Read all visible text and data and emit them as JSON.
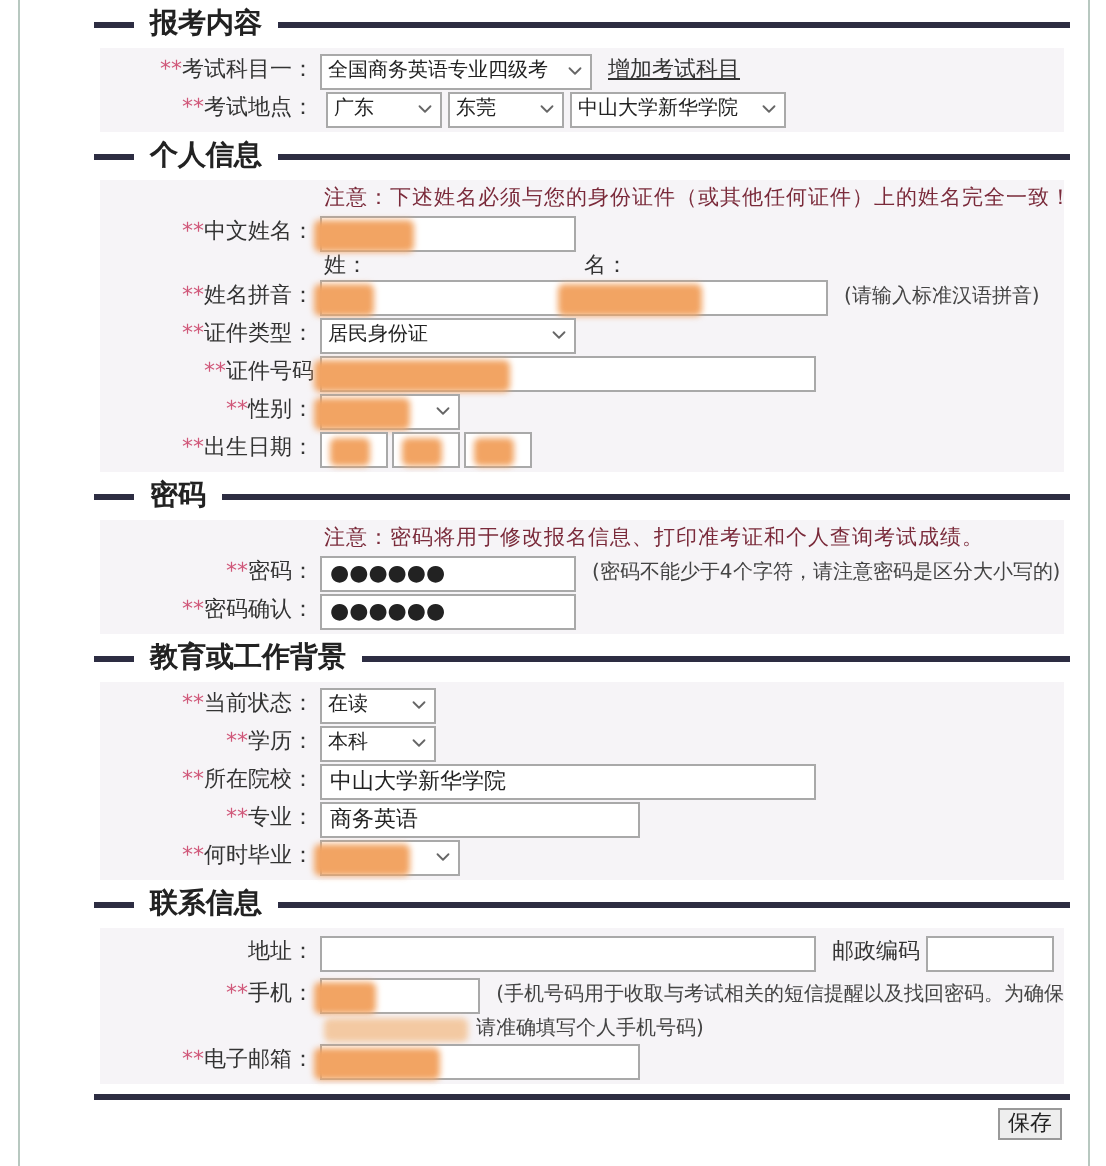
{
  "sections": [
    {
      "title": "报考内容",
      "rows": [
        {
          "kind": "select",
          "mark": "**",
          "label": "考试科目一：",
          "value": "全国商务英语专业四级考",
          "link": "增加考试科目"
        },
        {
          "kind": "selects",
          "mark": "**",
          "label": "考试地点：",
          "options": [
            "广东",
            "东莞",
            "中山大学新华学院"
          ]
        }
      ]
    },
    {
      "title": "个人信息",
      "note": "注意：下述姓名必须与您的身份证件（或其他任何证件）上的姓名完全一致！",
      "rows": [
        {
          "kind": "text",
          "mark": "**",
          "label": "中文姓名：",
          "redacted": true
        },
        {
          "kind": "name-pair",
          "mark": "**",
          "label": "姓名拼音：",
          "sublabels": [
            "姓：",
            "名："
          ],
          "redacted": true,
          "hint": "(请输入标准汉语拼音)"
        },
        {
          "kind": "select",
          "mark": "**",
          "label": "证件类型：",
          "value": "居民身份证"
        },
        {
          "kind": "text",
          "mark": "**",
          "label": "证件号码",
          "redacted": true
        },
        {
          "kind": "select",
          "mark": "**",
          "label": "性别：",
          "redacted": true
        },
        {
          "kind": "date",
          "mark": "**",
          "label": "出生日期：",
          "redacted": true
        }
      ]
    },
    {
      "title": "密码",
      "note": "注意：密码将用于修改报名信息、打印准考证和个人查询考试成绩。",
      "rows": [
        {
          "kind": "text",
          "mark": "**",
          "label": "密码：",
          "value": "●●●●●●",
          "hint": "(密码不能少于4个字符，请注意密码是区分大小写的)"
        },
        {
          "kind": "text",
          "mark": "**",
          "label": "密码确认：",
          "value": "●●●●●●"
        }
      ]
    },
    {
      "title": "教育或工作背景",
      "rows": [
        {
          "kind": "select",
          "mark": "**",
          "label": "当前状态：",
          "value": "在读"
        },
        {
          "kind": "select",
          "mark": "**",
          "label": "学历：",
          "value": "本科"
        },
        {
          "kind": "text",
          "mark": "**",
          "label": "所在院校：",
          "value": "中山大学新华学院"
        },
        {
          "kind": "text",
          "mark": "**",
          "label": "专业：",
          "value": "商务英语"
        },
        {
          "kind": "select",
          "mark": "**",
          "label": "何时毕业：",
          "redacted": true
        }
      ]
    },
    {
      "title": "联系信息",
      "rows": [
        {
          "kind": "address",
          "label": "地址：",
          "extra_label": "邮政编码"
        },
        {
          "kind": "phone",
          "mark": "**",
          "label": "手机：",
          "redacted": true,
          "hint": "(手机号码用于收取与考试相关的短信提醒以及找回密码。为确保",
          "hint_more": "请准确填写个人手机号码)"
        },
        {
          "kind": "text",
          "mark": "**",
          "label": "电子邮箱：",
          "redacted": true
        }
      ]
    }
  ],
  "save_button": "保存"
}
